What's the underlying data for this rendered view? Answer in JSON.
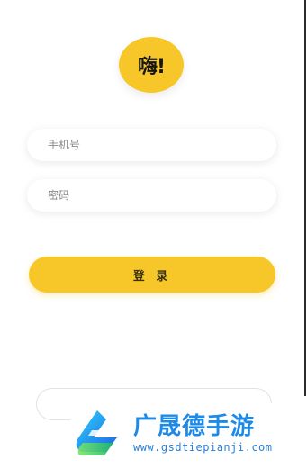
{
  "logo": {
    "text": "嗨!",
    "color": "#f7c72a"
  },
  "form": {
    "phone_placeholder": "手机号",
    "password_placeholder": "密码",
    "login_label": "登 录"
  },
  "watermark": {
    "title": "广晟德手游",
    "url": "www.gsdtiepianji.com",
    "color": "#1e8ae8"
  }
}
